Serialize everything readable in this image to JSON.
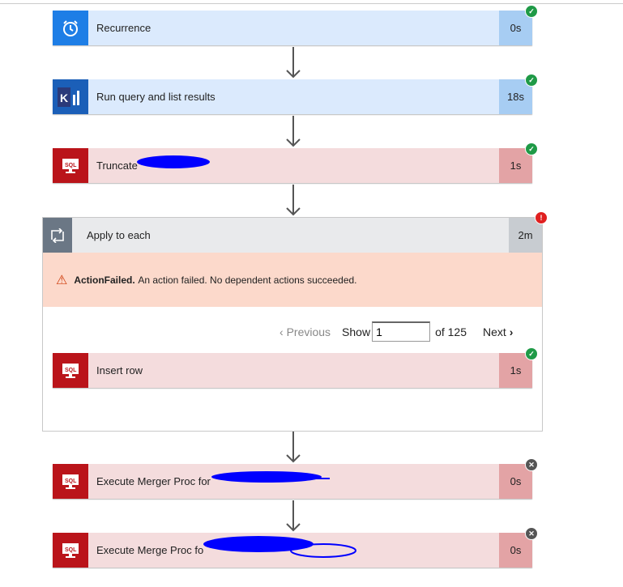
{
  "steps": [
    {
      "title": "Recurrence",
      "duration": "0s",
      "status": "succeeded",
      "icon": "alarm-clock-icon"
    },
    {
      "title": "Run query and list results",
      "duration": "18s",
      "status": "succeeded",
      "icon": "kusto-icon"
    },
    {
      "title": "Truncate",
      "duration": "1s",
      "status": "succeeded",
      "icon": "sql-icon"
    }
  ],
  "loop": {
    "title": "Apply to each",
    "duration": "2m",
    "status": "failed",
    "error": {
      "code": "ActionFailed.",
      "message": "An action failed. No dependent actions succeeded."
    },
    "pager": {
      "previous": "Previous",
      "show": "Show",
      "value": "1",
      "of": "of 125",
      "next": "Next"
    },
    "inner": {
      "title": "Insert row",
      "duration": "1s",
      "status": "succeeded"
    }
  },
  "after": [
    {
      "title": "Execute Merger Proc for",
      "duration": "0s",
      "status": "skipped"
    },
    {
      "title": "Execute Merge Proc fo",
      "duration": "0s",
      "status": "skipped"
    }
  ],
  "sql_label": "SQL",
  "colors": {
    "success": "#1f9a47",
    "failed": "#e02020",
    "skipped": "#555555",
    "redaction": "#0000ff"
  }
}
